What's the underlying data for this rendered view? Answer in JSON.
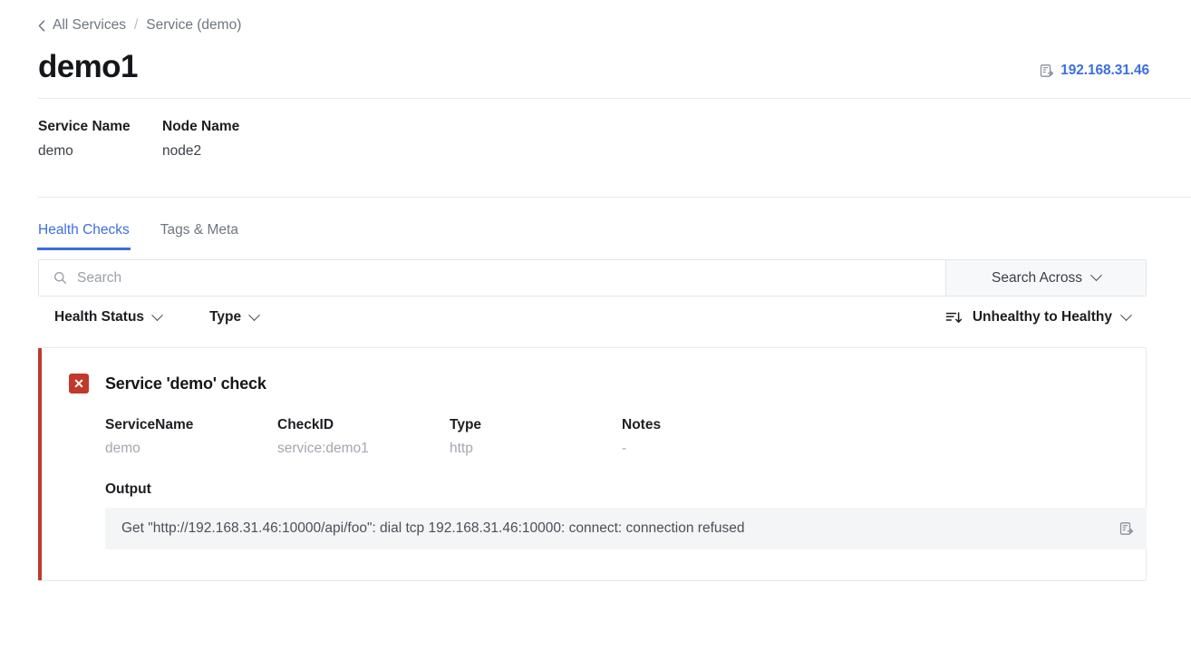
{
  "breadcrumb": {
    "back_icon": "chevron-left-icon",
    "root": "All Services",
    "separator": "/",
    "current": "Service (demo)"
  },
  "header": {
    "title": "demo1",
    "ip_address": "192.168.31.46",
    "ip_copy_icon": "clipboard-copy-icon",
    "accent_color": "#3b6fe0"
  },
  "meta": {
    "fields": [
      {
        "label": "Service Name",
        "value": "demo"
      },
      {
        "label": "Node Name",
        "value": "node2"
      }
    ]
  },
  "tabs": [
    {
      "label": "Health Checks",
      "active": true
    },
    {
      "label": "Tags & Meta",
      "active": false
    }
  ],
  "search": {
    "icon": "search-icon",
    "placeholder": "Search",
    "value": "",
    "across_label": "Search Across",
    "across_icon": "chevron-down-icon"
  },
  "filters": {
    "health_status_label": "Health Status",
    "health_status_icon": "chevron-down-icon",
    "type_label": "Type",
    "type_icon": "chevron-down-icon",
    "sort_icon": "sort-descending-icon",
    "sort_label": "Unhealthy to Healthy",
    "sort_chevron": "chevron-down-icon"
  },
  "check": {
    "status_icon": "error-x-icon",
    "status_glyph": "✕",
    "status_color": "#c0392b",
    "title": "Service 'demo' check",
    "details": [
      {
        "label": "ServiceName",
        "value": "demo"
      },
      {
        "label": "CheckID",
        "value": "service:demo1"
      },
      {
        "label": "Type",
        "value": "http"
      },
      {
        "label": "Notes",
        "value": "-"
      }
    ],
    "output_label": "Output",
    "output_text": "Get \"http://192.168.31.46:10000/api/foo\": dial tcp 192.168.31.46:10000: connect: connection refused",
    "output_copy_icon": "clipboard-copy-icon"
  }
}
